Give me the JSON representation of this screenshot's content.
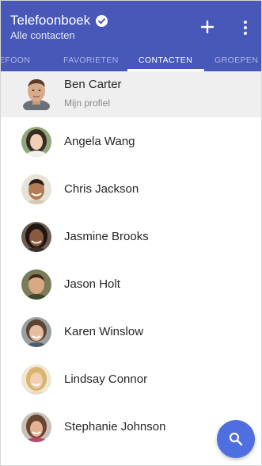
{
  "colors": {
    "appbar": "#4758b9",
    "fab": "#4f6ee0",
    "profile_bg": "#efefef"
  },
  "header": {
    "title": "Telefoonboek",
    "subtitle": "Alle contacten",
    "verified_icon": "check-circle-icon",
    "add_icon": "plus-icon",
    "more_icon": "more-vertical-icon"
  },
  "tabs": [
    {
      "label": "EFOON"
    },
    {
      "label": "FAVORIETEN"
    },
    {
      "label": "CONTACTEN",
      "active": true
    },
    {
      "label": "GROEPEN"
    }
  ],
  "profile": {
    "name": "Ben Carter",
    "subtitle": "Mijn profiel"
  },
  "contacts": [
    {
      "name": "Angela Wang"
    },
    {
      "name": "Chris Jackson"
    },
    {
      "name": "Jasmine Brooks"
    },
    {
      "name": "Jason Holt"
    },
    {
      "name": "Karen Winslow"
    },
    {
      "name": "Lindsay Connor"
    },
    {
      "name": "Stephanie Johnson"
    }
  ],
  "fab": {
    "icon": "search-icon"
  }
}
